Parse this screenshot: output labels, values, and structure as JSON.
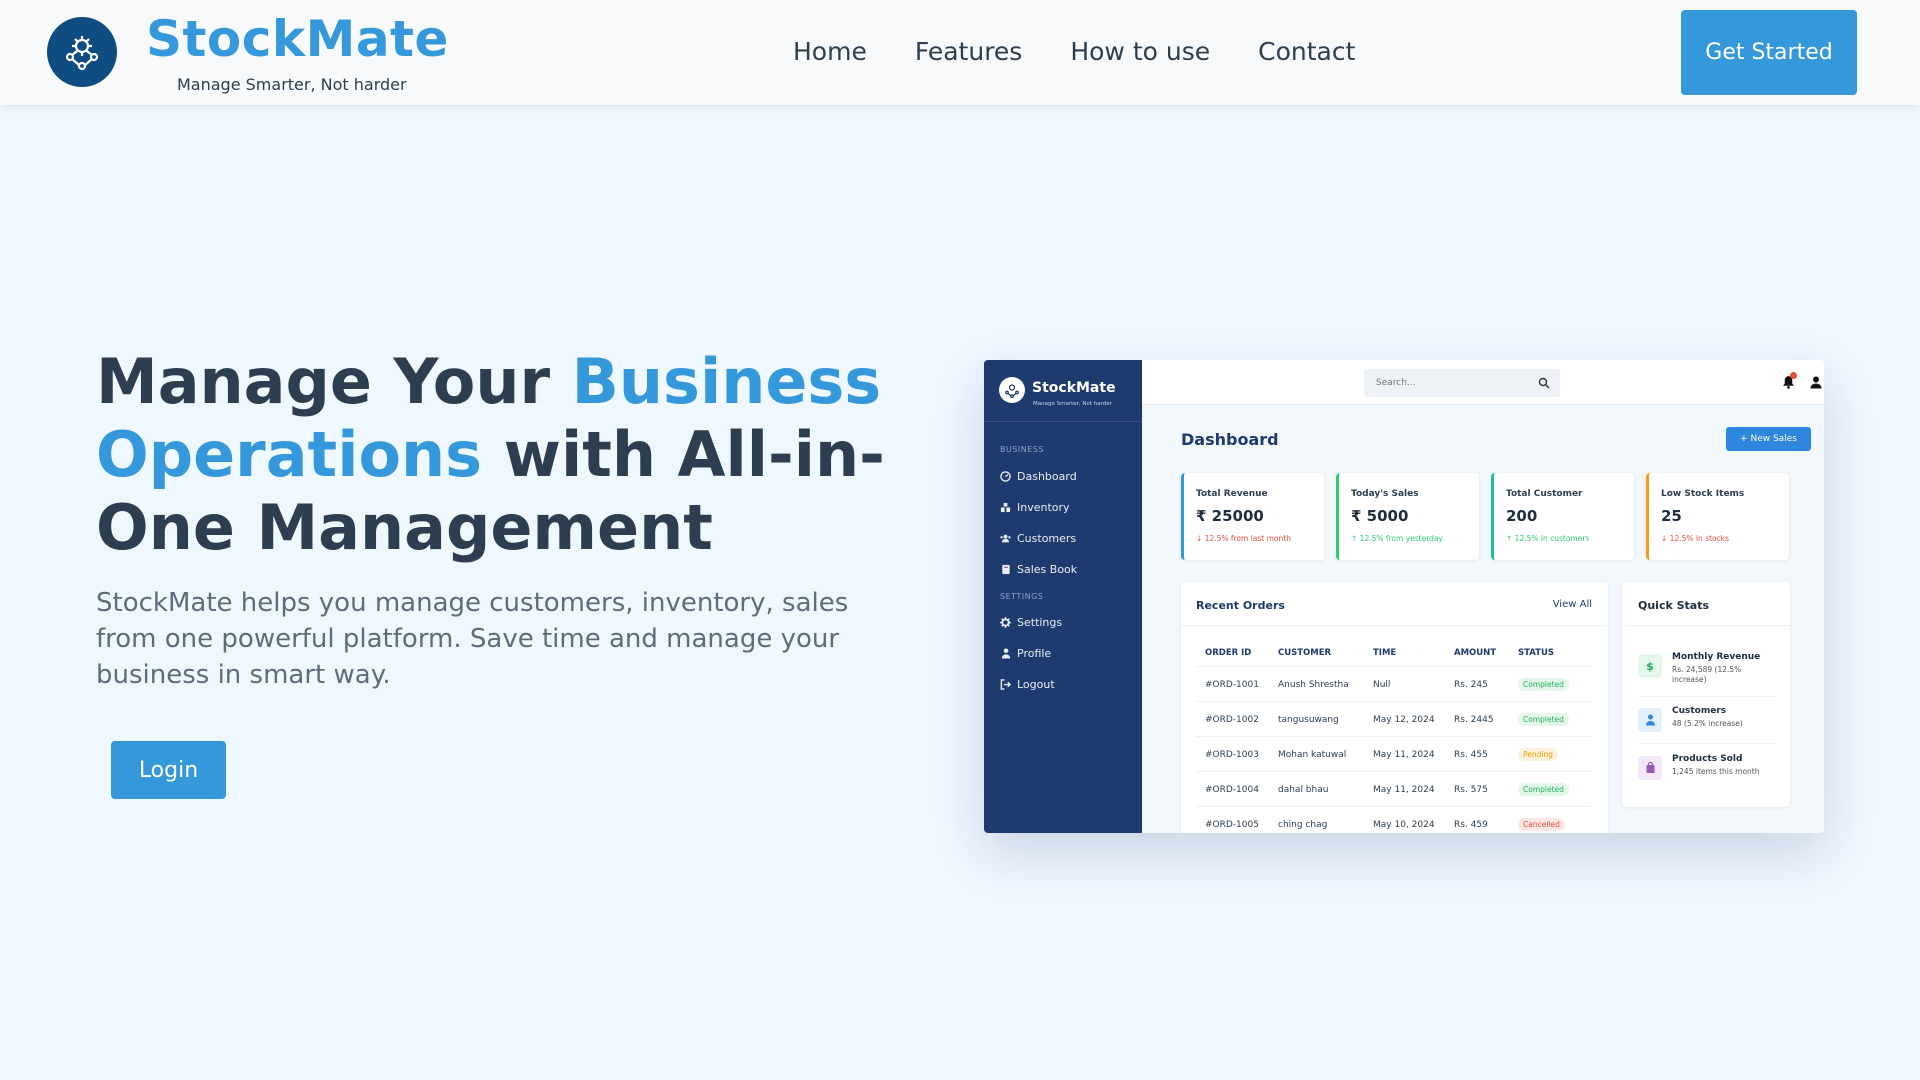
{
  "nav": {
    "brand": "StockMate",
    "tagline": "Manage Smarter, Not harder",
    "links": [
      "Home",
      "Features",
      "How to use",
      "Contact"
    ],
    "cta": "Get Started"
  },
  "hero": {
    "title_1": "Manage Your ",
    "title_accent": "Business Operations",
    "title_2": " with All-in-One Management",
    "description": "StockMate helps you manage customers, inventory, sales from one powerful platform. Save time and manage your business in smart way.",
    "login": "Login"
  },
  "colors": {
    "accent": "#3498db",
    "sidebar": "#1e3a6e",
    "background": "#eff7ff"
  },
  "mock": {
    "brand": "StockMate",
    "tagline": "Manage Smarter, Not harder",
    "section_business": "BUSINESS",
    "section_settings": "SETTINGS",
    "menu": {
      "dashboard": "Dashboard",
      "inventory": "Inventory",
      "customers": "Customers",
      "salesbook": "Sales Book",
      "settings": "Settings",
      "profile": "Profile",
      "logout": "Logout"
    },
    "search_placeholder": "Search...",
    "title": "Dashboard",
    "new_sales": "+ New Sales",
    "cards": [
      {
        "label": "Total Revenue",
        "value": "₹ 25000",
        "change": "↓ 12.5% from last month",
        "trend": "down",
        "color": "#3498db"
      },
      {
        "label": "Today's Sales",
        "value": "₹ 5000",
        "change": "↑ 12.5% from yesterday",
        "trend": "up",
        "color": "#2ecc71"
      },
      {
        "label": "Total Customer",
        "value": "200",
        "change": "↑ 12.5% in customers",
        "trend": "up",
        "color": "#1abc9c"
      },
      {
        "label": "Low Stock Items",
        "value": "25",
        "change": "↓ 12.5% in stocks",
        "trend": "down",
        "color": "#f39c12"
      }
    ],
    "orders": {
      "title": "Recent Orders",
      "view_all": "View All",
      "headers": [
        "ORDER ID",
        "CUSTOMER",
        "TIME",
        "AMOUNT",
        "STATUS"
      ],
      "rows": [
        {
          "id": "#ORD-1001",
          "customer": "Anush Shrestha",
          "time": "Null",
          "amount": "Rs. 245",
          "status": "Completed"
        },
        {
          "id": "#ORD-1002",
          "customer": "tangusuwang",
          "time": "May 12, 2024",
          "amount": "Rs. 2445",
          "status": "Completed"
        },
        {
          "id": "#ORD-1003",
          "customer": "Mohan katuwal",
          "time": "May 11, 2024",
          "amount": "Rs. 455",
          "status": "Pending"
        },
        {
          "id": "#ORD-1004",
          "customer": "dahal bhau",
          "time": "May 11, 2024",
          "amount": "Rs. 575",
          "status": "Completed"
        },
        {
          "id": "#ORD-1005",
          "customer": "ching chag",
          "time": "May 10, 2024",
          "amount": "Rs. 459",
          "status": "Cancelled"
        }
      ]
    },
    "quick_stats": {
      "title": "Quick Stats",
      "items": [
        {
          "title": "Monthly Revenue",
          "sub": "Rs. 24,589 (12.5% increase)"
        },
        {
          "title": "Customers",
          "sub": "48 (5.2% increase)"
        },
        {
          "title": "Products Sold",
          "sub": "1,245 items this month"
        }
      ]
    }
  }
}
